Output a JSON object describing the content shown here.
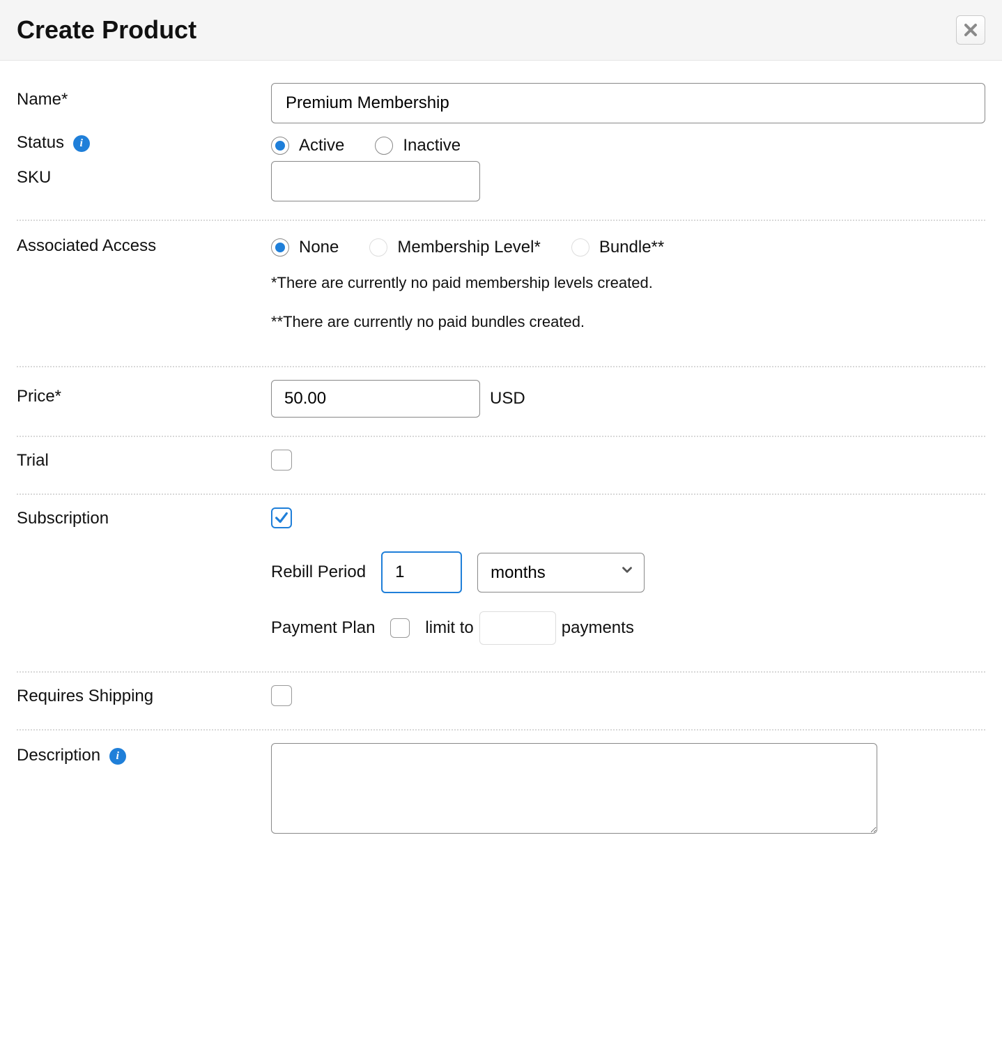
{
  "header": {
    "title": "Create Product"
  },
  "labels": {
    "name": "Name*",
    "status": "Status",
    "sku": "SKU",
    "associated": "Associated Access",
    "price": "Price*",
    "trial": "Trial",
    "subscription": "Subscription",
    "rebill": "Rebill Period",
    "paymentPlan": "Payment Plan",
    "limitTo": "limit to",
    "payments": "payments",
    "requiresShipping": "Requires Shipping",
    "description": "Description"
  },
  "name": {
    "value": "Premium Membership"
  },
  "status": {
    "active": "Active",
    "inactive": "Inactive",
    "selected": "active"
  },
  "sku": {
    "value": ""
  },
  "access": {
    "none": "None",
    "membership": "Membership Level*",
    "bundle": "Bundle**",
    "footnote1": "*There are currently no paid membership levels created.",
    "footnote2": "**There are currently no paid bundles created."
  },
  "price": {
    "value": "50.00",
    "currency": "USD"
  },
  "trial": {
    "checked": false
  },
  "subscription": {
    "checked": true,
    "rebill_count": "1",
    "rebill_unit": "months",
    "limit_checked": false,
    "limit_payments": ""
  },
  "shipping": {
    "checked": false
  },
  "description": {
    "value": ""
  }
}
